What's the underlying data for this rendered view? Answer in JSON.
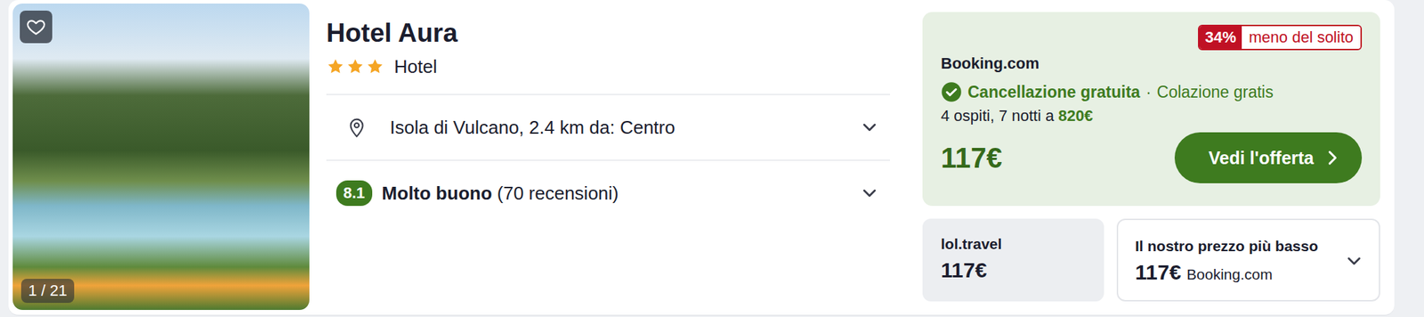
{
  "hotel": {
    "name": "Hotel Aura",
    "stars": 3,
    "type": "Hotel",
    "photo_counter": "1 / 21",
    "favorite": false,
    "location": "Isola di Vulcano, 2.4 km da: Centro",
    "rating": {
      "score": "8.1",
      "label": "Molto buono",
      "count": "(70 recensioni)"
    }
  },
  "offer": {
    "discount": "34%",
    "discount_label": "meno del solito",
    "provider": "Booking.com",
    "cancellation": "Cancellazione gratuita",
    "separator": "·",
    "breakfast": "Colazione gratis",
    "stay_text": "4 ospiti, 7 notti a",
    "stay_total": "820€",
    "price": "117€",
    "button": "Vedi l'offerta"
  },
  "alternatives": [
    {
      "provider": "lol.travel",
      "price": "117€"
    }
  ],
  "lowest": {
    "label": "Il nostro prezzo più basso",
    "price": "117€",
    "provider": "Booking.com"
  }
}
